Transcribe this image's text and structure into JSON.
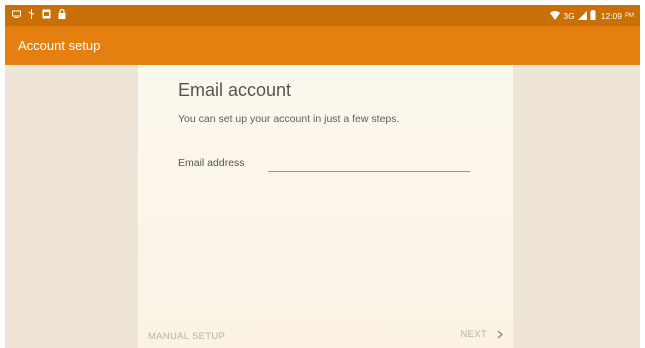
{
  "status_bar": {
    "icons_left": [
      "screen-icon",
      "usb-icon",
      "app-icon",
      "lock-icon"
    ],
    "network": "3G",
    "time": "12:09",
    "ampm": "PM"
  },
  "app_bar": {
    "title": "Account setup"
  },
  "main": {
    "heading": "Email account",
    "subtext": "You can set up your account in just a few steps.",
    "email_label": "Email address",
    "email_value": ""
  },
  "footer": {
    "manual_setup": "MANUAL SETUP",
    "next": "NEXT"
  },
  "colors": {
    "status_bar": "#c86f08",
    "app_bar": "#e57f10",
    "background": "#efe5d7",
    "content": "#fbf2e3"
  }
}
